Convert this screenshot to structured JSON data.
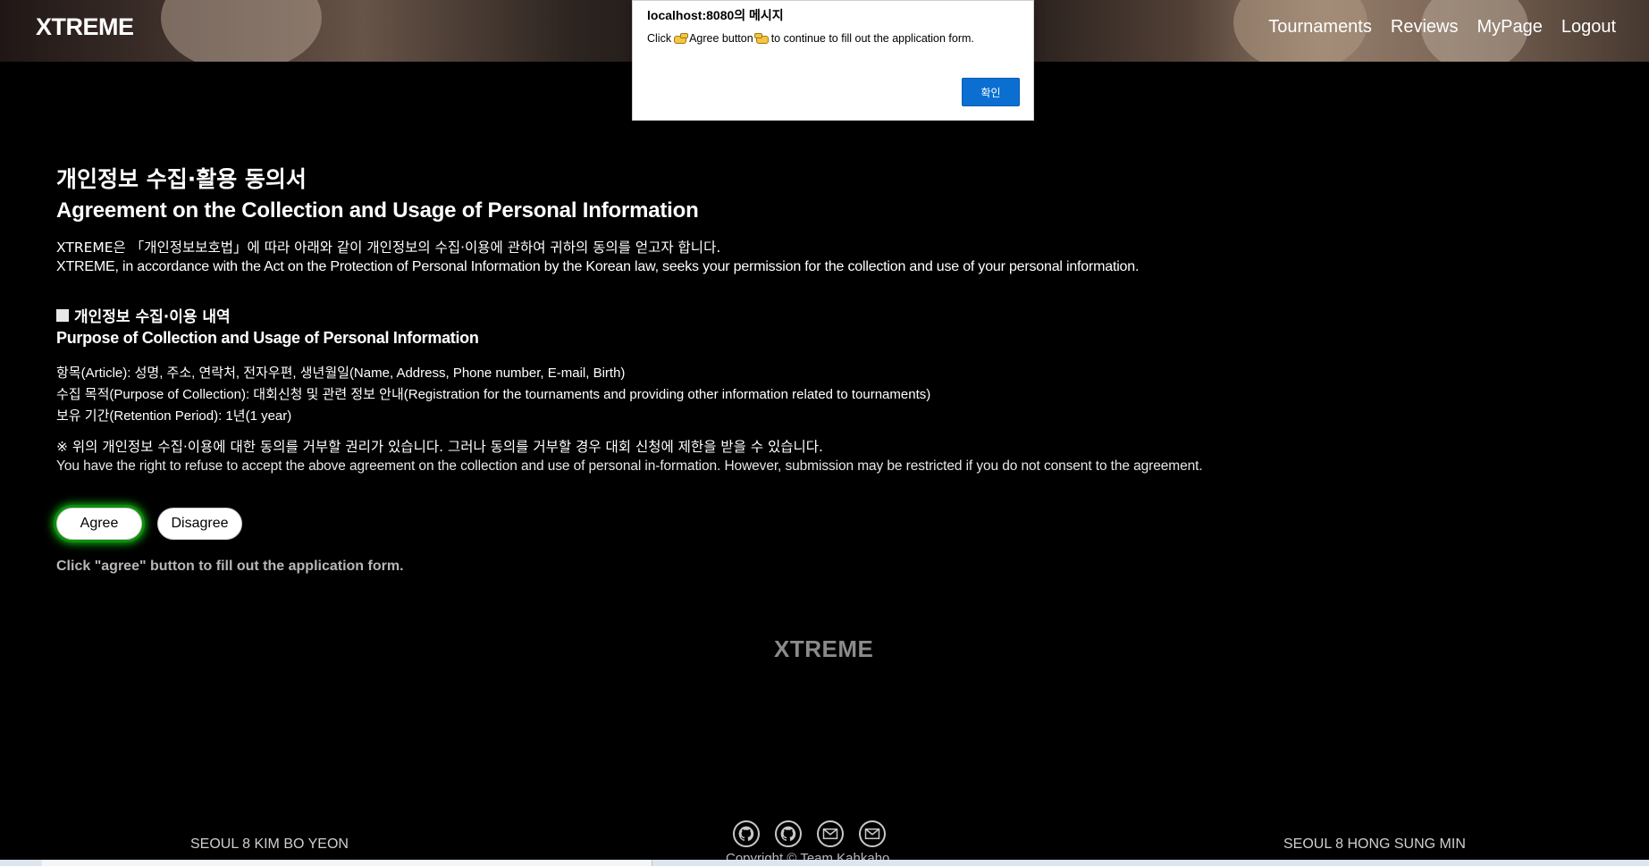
{
  "header": {
    "logo": "XTREME",
    "nav": [
      "Tournaments",
      "Reviews",
      "MyPage",
      "Logout"
    ]
  },
  "dialog": {
    "title": "localhost:8080의 메시지",
    "message_pre": "Click ",
    "message_mid": "Agree button",
    "message_post": " to continue to fill out the application form.",
    "ok_label": "확인"
  },
  "main": {
    "title_ko": "개인정보 수집·활용 동의서",
    "title_en": "Agreement on the Collection and Usage of Personal Information",
    "intro_ko": "XTREME은 「개인정보보호법」에 따라 아래와 같이 개인정보의 수집·이용에 관하여 귀하의 동의를 얻고자 합니다.",
    "intro_en": "XTREME, in accordance with the Act on the Protection of Personal Information by the Korean law, seeks your permission for the collection and use of your personal information.",
    "section_ko": "개인정보 수집·이용 내역",
    "section_en": "Purpose of Collection and Usage of Personal Information",
    "lines": [
      "항목(Article): 성명, 주소, 연락처, 전자우편, 생년월일(Name, Address, Phone number, E-mail, Birth)",
      "수집 목적(Purpose of Collection): 대회신청 및 관련 정보 안내(Registration for the tournaments and providing other information related to tournaments)",
      "보유 기간(Retention Period): 1년(1 year)"
    ],
    "note_ko": "※ 위의 개인정보 수집·이용에 대한 동의를 거부할 권리가 있습니다. 그러나 동의를 거부할 경우 대회 신청에 제한을 받을 수 있습니다.",
    "note_en": "You have the right to refuse to accept the above agreement on the collection and use of personal in-formation. However, submission may be restricted if you do not consent to the agreement.",
    "agree_label": "Agree",
    "disagree_label": "Disagree",
    "hint": "Click \"agree\" button to fill out the application form."
  },
  "footer": {
    "logo": "XTREME",
    "left_credit": "SEOUL 8 KIM BO YEON",
    "right_credit": "SEOUL 8 HONG SUNG MIN",
    "icons": [
      "github-icon",
      "github-icon",
      "mail-icon",
      "mail-icon"
    ],
    "copyright": "Copyright © Team Kahkaho"
  }
}
